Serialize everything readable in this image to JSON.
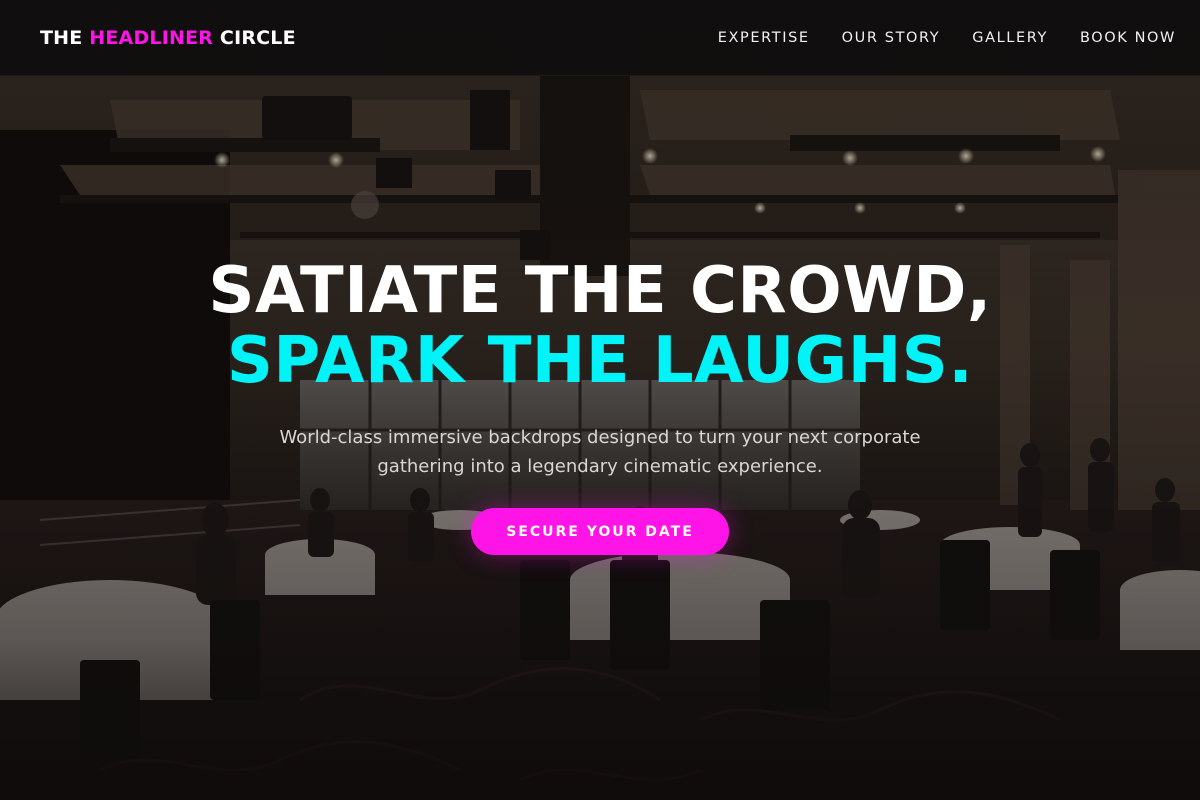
{
  "header": {
    "brand_prefix": "THE ",
    "brand_accent": "HEADLINER",
    "brand_suffix": " CIRCLE",
    "nav": [
      {
        "label": "EXPERTISE"
      },
      {
        "label": "OUR STORY"
      },
      {
        "label": "GALLERY"
      },
      {
        "label": "BOOK NOW"
      }
    ]
  },
  "hero": {
    "headline_line1": "SATIATE THE CROWD,",
    "headline_line2": "SPARK THE LAUGHS.",
    "subtitle": "World-class immersive backdrops designed to turn your next corporate gathering into a legendary cinematic experience.",
    "cta_label": "SECURE YOUR DATE"
  },
  "colors": {
    "accent_magenta": "#ff14e8",
    "accent_cyan": "#00f3f7",
    "nav_background": "#110f0f",
    "text_light": "#d9d6d4"
  }
}
